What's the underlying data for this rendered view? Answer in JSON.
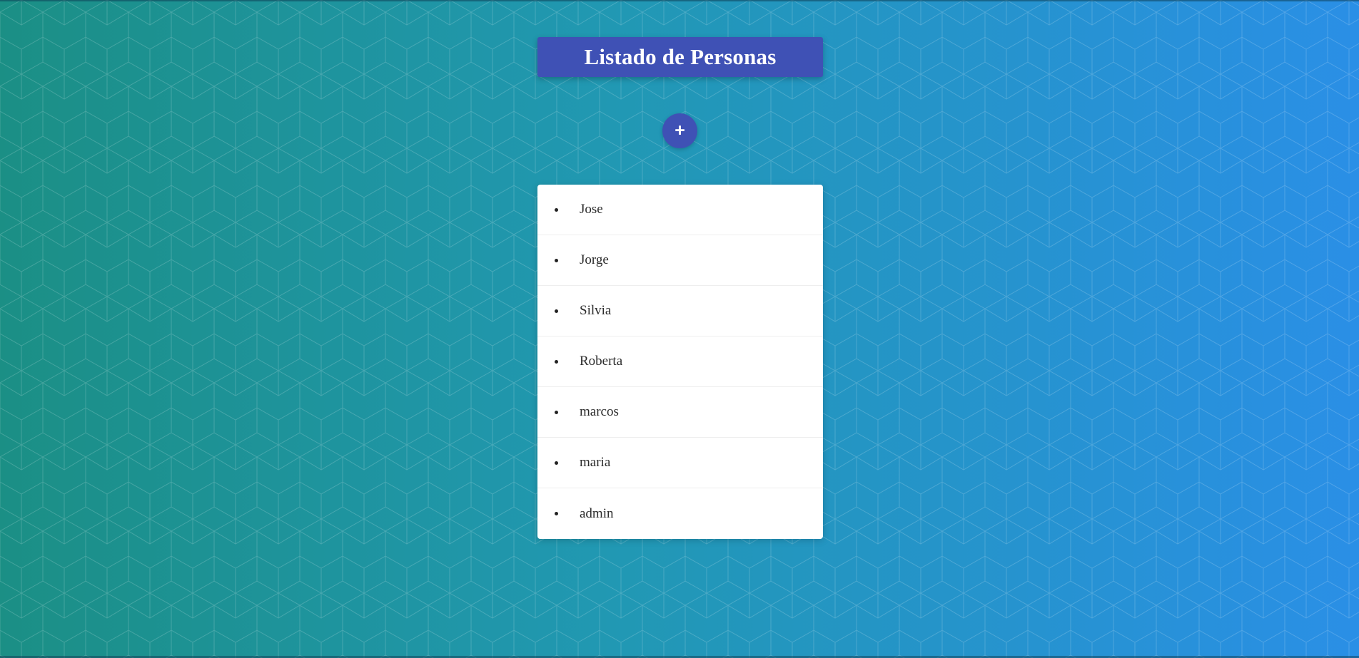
{
  "page": {
    "title": "Listado de Personas",
    "add_button_label": "+"
  },
  "persons": [
    {
      "name": "Jose"
    },
    {
      "name": "Jorge"
    },
    {
      "name": "Silvia"
    },
    {
      "name": "Roberta"
    },
    {
      "name": "marcos"
    },
    {
      "name": "maria"
    },
    {
      "name": "admin"
    }
  ],
  "colors": {
    "accent": "#3f51b5",
    "background_start": "#1b8f85",
    "background_end": "#2a8fe6",
    "card": "#ffffff"
  }
}
